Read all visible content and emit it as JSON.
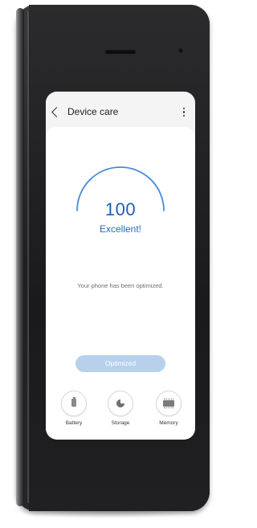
{
  "header": {
    "title": "Device care",
    "back_icon": "chevron-left-icon",
    "menu_icon": "more-vertical-icon"
  },
  "score": {
    "value": "100",
    "status": "Excellent!",
    "gauge_color": "#4a8bd6",
    "text_color": "#1f5fb2"
  },
  "message": "Your phone has been optimized.",
  "action_button": {
    "label": "Optimized",
    "color": "#b7d0ec"
  },
  "categories": [
    {
      "label": "Battery",
      "icon": "battery-icon"
    },
    {
      "label": "Storage",
      "icon": "storage-icon"
    },
    {
      "label": "Memory",
      "icon": "memory-icon"
    }
  ]
}
